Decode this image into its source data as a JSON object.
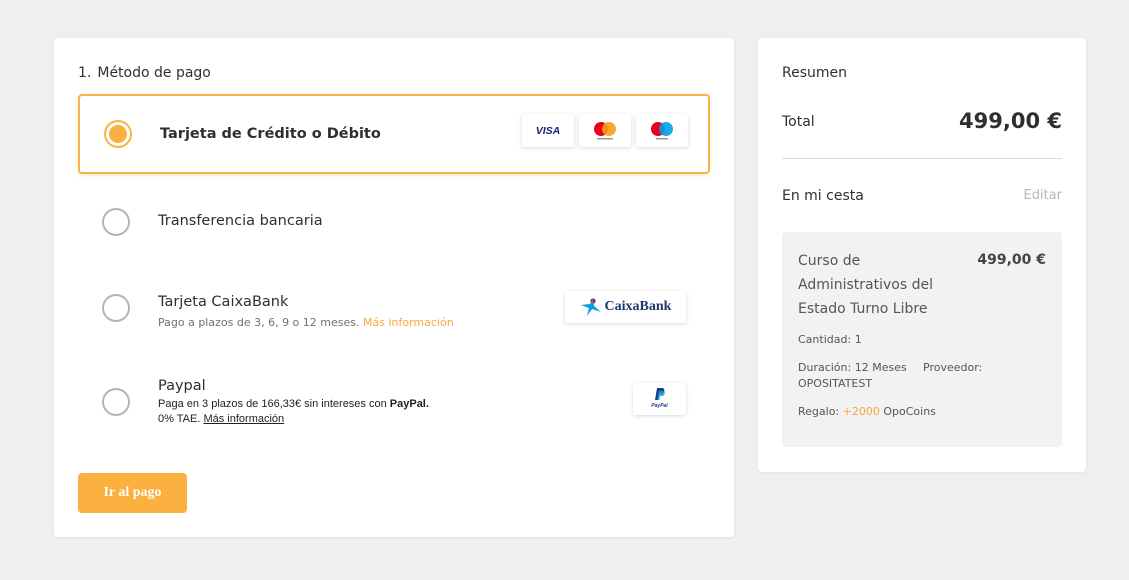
{
  "payment": {
    "step_number": "1.",
    "title": "Método de pago",
    "options": [
      {
        "label": "Tarjeta de Crédito o Débito",
        "selected": true,
        "logos": [
          {
            "name": "visa-logo",
            "text": "VISA"
          },
          {
            "name": "mastercard-logo",
            "text": "mastercard"
          },
          {
            "name": "maestro-logo",
            "text": "maestro"
          }
        ]
      },
      {
        "label": "Transferencia bancaria",
        "selected": false
      },
      {
        "label": "Tarjeta CaixaBank",
        "selected": false,
        "subtitle": "Pago a plazos de 3, 6, 9 o 12 meses.",
        "link": "Más información",
        "logo_text": "CaixaBank"
      },
      {
        "label": "Paypal",
        "selected": false,
        "desc_prefix": "Paga en 3 plazos de 166,33€ sin intereses con",
        "desc_brand": "PayPal.",
        "desc_tae": "0% TAE.",
        "link": "Más información",
        "logo_text": "PayPal"
      }
    ],
    "submit_label": "Ir al pago"
  },
  "summary": {
    "title": "Resumen",
    "total_label": "Total",
    "total_value": "499,00 €",
    "basket_label": "En mi cesta",
    "edit_label": "Editar",
    "item": {
      "name": "Curso de Administrativos del Estado Turno Libre",
      "price": "499,00 €",
      "quantity_label": "Cantidad:",
      "quantity": "1",
      "duration_label": "Duración:",
      "duration": "12 Meses",
      "provider_label": "Proveedor:",
      "provider": "OPOSITATEST",
      "gift_label": "Regalo:",
      "gift_amount": "+2000",
      "gift_unit": "OpoCoins"
    }
  },
  "colors": {
    "accent": "#fbb040",
    "background": "#eeeff1",
    "caixabank_blue": "#1b3a6b",
    "caixabank_star": "#009ee0"
  }
}
